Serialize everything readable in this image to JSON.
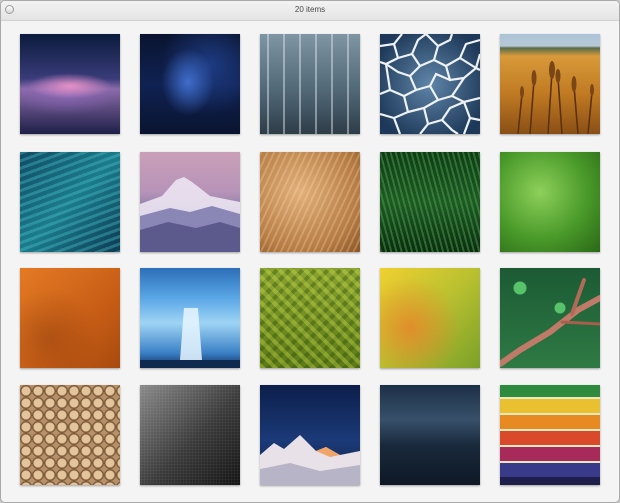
{
  "window": {
    "title": "20 items"
  },
  "items": [
    {
      "id": 1,
      "name": "",
      "icon": "purple-clouds-wallpaper"
    },
    {
      "id": 2,
      "name": "",
      "icon": "blue-nebula-wallpaper"
    },
    {
      "id": 3,
      "name": "",
      "icon": "rain-glass-wallpaper"
    },
    {
      "id": 4,
      "name": "",
      "icon": "cracked-glass-wallpaper"
    },
    {
      "id": 5,
      "name": "",
      "icon": "golden-grass-wallpaper"
    },
    {
      "id": 6,
      "name": "",
      "icon": "teal-waves-wallpaper"
    },
    {
      "id": 7,
      "name": "",
      "icon": "purple-mountain-wallpaper"
    },
    {
      "id": 8,
      "name": "",
      "icon": "fur-texture-wallpaper"
    },
    {
      "id": 9,
      "name": "",
      "icon": "green-grass-wallpaper"
    },
    {
      "id": 10,
      "name": "",
      "icon": "green-texture-wallpaper"
    },
    {
      "id": 11,
      "name": "",
      "icon": "orange-rust-wallpaper"
    },
    {
      "id": 12,
      "name": "",
      "icon": "blue-glacier-wallpaper"
    },
    {
      "id": 13,
      "name": "",
      "icon": "green-leaves-wallpaper"
    },
    {
      "id": 14,
      "name": "",
      "icon": "yellow-abstract-wallpaper"
    },
    {
      "id": 15,
      "name": "",
      "icon": "moss-branch-wallpaper"
    },
    {
      "id": 16,
      "name": "",
      "icon": "pebbles-wallpaper"
    },
    {
      "id": 17,
      "name": "",
      "icon": "dark-gradient-wallpaper"
    },
    {
      "id": 18,
      "name": "",
      "icon": "night-mountain-wallpaper"
    },
    {
      "id": 19,
      "name": "",
      "icon": "stormy-sea-wallpaper"
    },
    {
      "id": 20,
      "name": "",
      "icon": "rainbow-wood-wallpaper"
    }
  ],
  "colors": {
    "window_background": "#f4f4f4",
    "title_text": "#4a4a4a"
  }
}
